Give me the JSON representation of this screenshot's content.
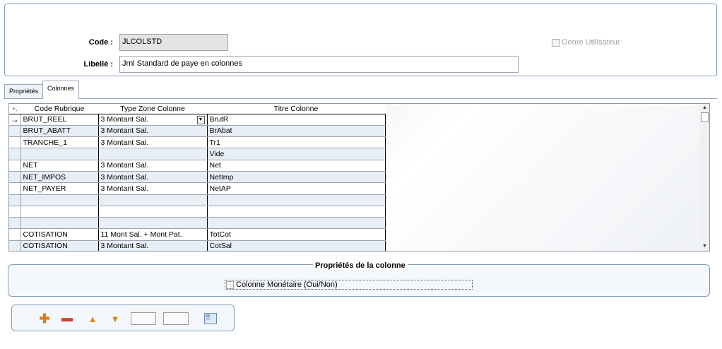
{
  "header": {
    "code_label": "Code :",
    "code_value": "JLCOLSTD",
    "libelle_label": "Libellé :",
    "libelle_value": "Jrnl Standard de paye en colonnes",
    "genre_label": "Genre Utilisateur"
  },
  "tabs": [
    {
      "label": "Propriétés"
    },
    {
      "label": "Colonnes"
    }
  ],
  "grid": {
    "add_symbol": "+.",
    "columns": [
      "Code Rubrique",
      "Type Zone Colonne",
      "Titre Colonne"
    ],
    "current_row_marker": "→",
    "dropdown_glyph": "▼",
    "rows": [
      {
        "code": "BRUT_REEL",
        "type": "3  Montant Sal.",
        "titre": "BrutR"
      },
      {
        "code": "BRUT_ABATT",
        "type": "3  Montant Sal.",
        "titre": "BrAbat"
      },
      {
        "code": "TRANCHE_1",
        "type": "3  Montant Sal.",
        "titre": "Tr1"
      },
      {
        "code": "",
        "type": "",
        "titre": "Vide"
      },
      {
        "code": "NET",
        "type": "3  Montant Sal.",
        "titre": "Net"
      },
      {
        "code": "NET_IMPOS",
        "type": "3  Montant Sal.",
        "titre": "NetImp"
      },
      {
        "code": "NET_PAYER",
        "type": "3  Montant Sal.",
        "titre": "NetAP"
      },
      {
        "code": "",
        "type": "",
        "titre": ""
      },
      {
        "code": "",
        "type": "",
        "titre": ""
      },
      {
        "code": "",
        "type": "",
        "titre": ""
      },
      {
        "code": "COTISATION",
        "type": "11 Mont Sal. + Mont Pat.",
        "titre": "TotCot"
      },
      {
        "code": "COTISATION",
        "type": "3  Montant Sal.",
        "titre": "CotSal"
      }
    ]
  },
  "props": {
    "title": "Propriétés de la colonne",
    "monetaire_label": "Colonne Monétaire (Oui/Non)"
  },
  "toolbar": {
    "add_icon": "add-icon",
    "remove_icon": "remove-icon",
    "up_icon": "move-up-icon",
    "down_icon": "move-down-icon"
  }
}
